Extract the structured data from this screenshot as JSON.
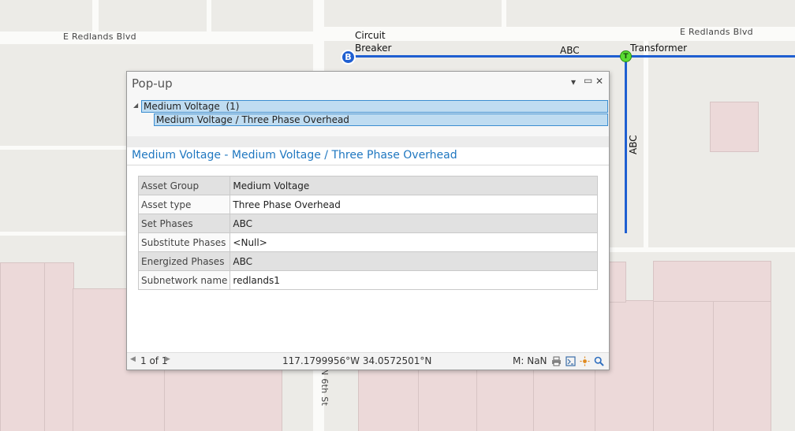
{
  "map": {
    "street_labels": {
      "redlands_west": "E Redlands Blvd",
      "redlands_east": "E Redlands Blvd",
      "sixth_st": "N 6th St"
    },
    "line_labels": {
      "horizontal_phase": "ABC",
      "vertical_phase": "ABC"
    },
    "features": {
      "breaker": {
        "symbol": "B",
        "label_line1": "Circuit",
        "label_line2": "Breaker"
      },
      "transformer": {
        "symbol": "T",
        "label": "Transformer"
      }
    },
    "colors": {
      "line": "#1f5fd1",
      "transformer": "#5adc32",
      "parcel": "#ecd9d9"
    }
  },
  "popup": {
    "title": "Pop-up",
    "controls": {
      "dropdown": "▾",
      "maximize": "▭",
      "close": "✕"
    },
    "tree": {
      "parent_label": "Medium Voltage  (1)",
      "child_label": "Medium Voltage / Three Phase Overhead"
    },
    "section_title": "Medium Voltage - Medium Voltage / Three Phase Overhead",
    "attributes": [
      {
        "field": "Asset Group",
        "value": "Medium Voltage"
      },
      {
        "field": "Asset type",
        "value": "Three Phase Overhead"
      },
      {
        "field": "Set Phases",
        "value": "ABC"
      },
      {
        "field": "Substitute Phases",
        "value": "<Null>"
      },
      {
        "field": "Energized Phases",
        "value": "ABC"
      },
      {
        "field": "Subnetwork name",
        "value": "redlands1"
      }
    ],
    "status": {
      "page": "1 of 1",
      "coordinates": "117.1799956°W 34.0572501°N",
      "m_value": "M: NaN"
    },
    "accent_color": "#1f77c0"
  }
}
